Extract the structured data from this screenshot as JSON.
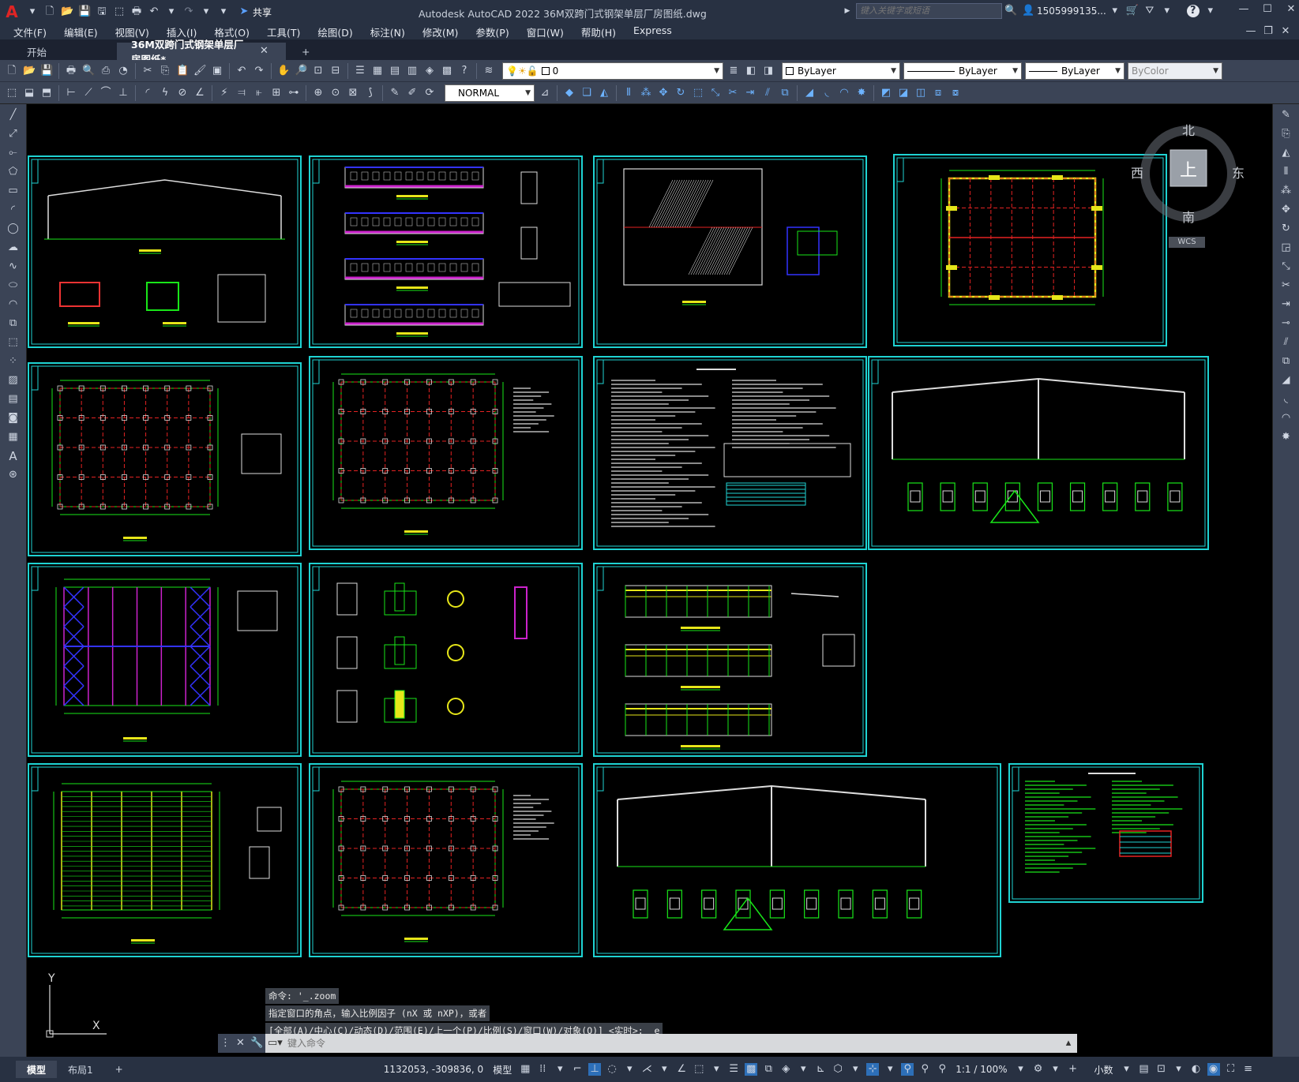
{
  "titlebar": {
    "app_logo": "A",
    "share_label": "共享",
    "title": "Autodesk AutoCAD 2022    36M双跨门式钢架单层厂房图纸.dwg",
    "search_placeholder": "键入关键字或短语",
    "user": "1505999135...",
    "icons": [
      "new-icon",
      "open-icon",
      "save-icon",
      "saveas-icon",
      "plot-icon",
      "undo-icon",
      "redo-icon",
      "share-icon",
      "search-icon",
      "user-icon",
      "cart-icon",
      "help-icon",
      "minimize-icon",
      "maximize-icon",
      "close-icon"
    ]
  },
  "menubar": {
    "items": [
      "文件(F)",
      "编辑(E)",
      "视图(V)",
      "插入(I)",
      "格式(O)",
      "工具(T)",
      "绘图(D)",
      "标注(N)",
      "修改(M)",
      "参数(P)",
      "窗口(W)",
      "帮助(H)",
      "Express"
    ]
  },
  "tabs": {
    "start": "开始",
    "active": "36M双跨门式钢架单层厂房图纸*",
    "add": "+"
  },
  "toolbar1": {
    "layer_value": "0",
    "color_value": "ByLayer",
    "linetype_value": "ByLayer",
    "lineweight_value": "ByLayer",
    "plotstyle_value": "ByColor"
  },
  "toolbar2": {
    "dimstyle_value": "NORMAL"
  },
  "viewcube": {
    "north": "北",
    "south": "南",
    "east": "东",
    "west": "西",
    "top": "上",
    "wcs": "WCS"
  },
  "ucs": {
    "x_label": "X",
    "y_label": "Y"
  },
  "command": {
    "history": [
      "命令: '_.zoom",
      "指定窗口的角点，输入比例因子 (nX 或 nXP)，或者",
      "[全部(A)/中心(C)/动态(D)/范围(E)/上一个(P)/比例(S)/窗口(W)/对象(O)] <实时>: _e"
    ],
    "placeholder": "键入命令"
  },
  "statusbar": {
    "model_tab": "模型",
    "layout_tab": "布局1",
    "add_layout": "+",
    "coords": "1132053, -309836, 0",
    "model_label": "模型",
    "scale": "1:1 / 100%",
    "units": "小数"
  },
  "colors": {
    "sheet_border": "#1fd3d3",
    "grid_green": "#19e619",
    "axis_red": "#e52222",
    "purple": "#cc22cc",
    "yellow": "#e6e619",
    "blue": "#3333ff"
  }
}
